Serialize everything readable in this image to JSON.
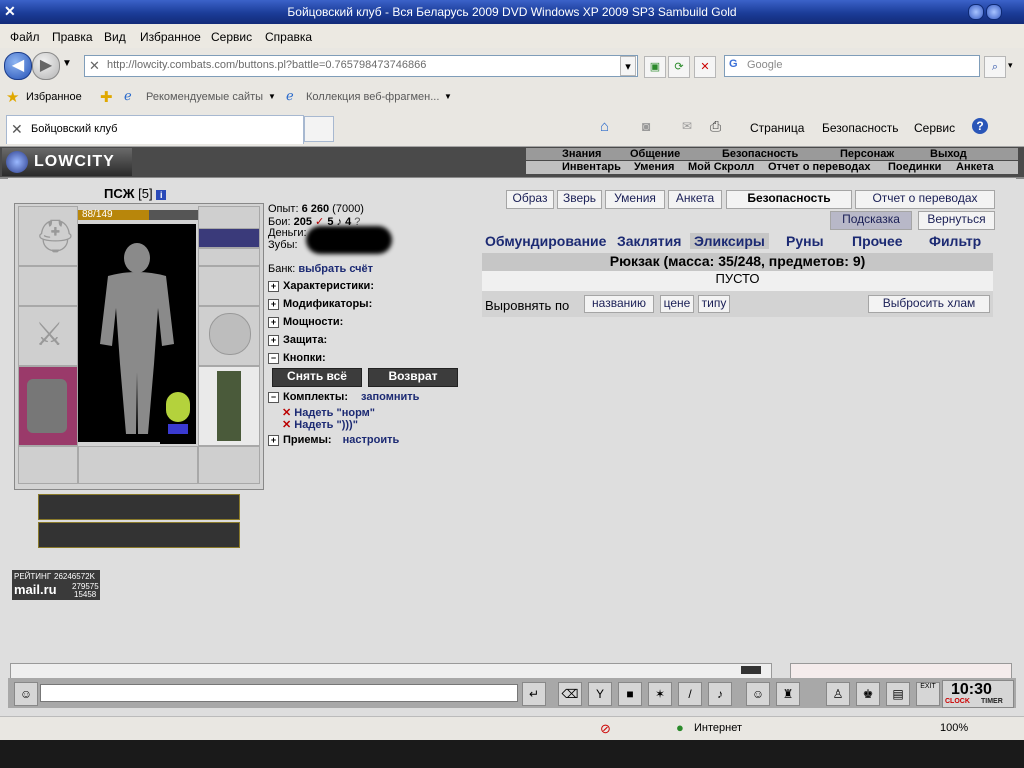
{
  "window": {
    "title": "Бойцовский клуб - Вся Беларусь 2009 DVD Windows XP 2009 SP3 Sambuild Gold"
  },
  "menu": [
    "Файл",
    "Правка",
    "Вид",
    "Избранное",
    "Сервис",
    "Справка"
  ],
  "address": {
    "url": "http://lowcity.combats.com/buttons.pl?battle=0.765798473746866"
  },
  "search": {
    "placeholder": "Google"
  },
  "favbar": {
    "favorites": "Избранное",
    "recommended": "Рекомендуемые сайты",
    "collection": "Коллекция веб-фрагмен..."
  },
  "tab": {
    "label": "Бойцовский клуб"
  },
  "commandbar": {
    "page": "Страница",
    "security": "Безопасность",
    "service": "Сервис"
  },
  "game": {
    "logo": "LOWCITY",
    "nav_top": [
      "Знания",
      "Общение",
      "Безопасность",
      "Персонаж",
      "Выход"
    ],
    "nav_bottom": [
      "Инвентарь",
      "Умения",
      "Мой Скролл",
      "Отчет о переводах",
      "Поединки",
      "Анкета"
    ],
    "character": {
      "name": "ПСЖ",
      "level": "[5]",
      "hp": "88/149",
      "hp_fraction": 0.59
    },
    "stats": {
      "exp_label": "Опыт:",
      "exp_value": "6 260",
      "exp_next": "(7000)",
      "fights_label": "Бои:",
      "fights_value": "205",
      "wins": "5",
      "losses": "4",
      "money_label": "Деньги:",
      "teeth_label": "Зубы:",
      "bank_label": "Банк:",
      "bank_link": "выбрать счёт"
    },
    "sections": [
      "Характеристики:",
      "Модификаторы:",
      "Мощности:",
      "Защита:",
      "Кнопки:"
    ],
    "buttons": {
      "remove_all": "Снять всё",
      "return": "Возврат"
    },
    "sets": {
      "label": "Комплекты:",
      "link": "запомнить",
      "items": [
        "Надеть \"норм\"",
        "Надеть \")))\""
      ]
    },
    "moves": {
      "label": "Приемы:",
      "link": "настроить"
    },
    "top_buttons": [
      "Образ",
      "Зверь",
      "Умения",
      "Анкета",
      "Безопасность",
      "Отчет о переводах"
    ],
    "hint": "Подсказка",
    "back": "Вернуться",
    "inv_tabs": [
      "Обмундирование",
      "Заклятия",
      "Эликсиры",
      "Руны",
      "Прочее",
      "Фильтр"
    ],
    "bag": "Рюкзак (масса: 35/248, предметов: 9)",
    "empty": "ПУСТО",
    "sort_label": "Выровнять по",
    "sort_options": [
      "названию",
      "цене",
      "типу"
    ],
    "throw_junk": "Выбросить хлам",
    "rating": {
      "label": "РЕЙТИНГ",
      "value": "26246572K",
      "mail": "mail.ru",
      "num1": "279575",
      "num2": "15458"
    },
    "clock": "10:30",
    "clock_label": "CLOCK",
    "timer_label": "TIMER",
    "exit_label": "EXIT"
  },
  "status": {
    "zone": "Интернет",
    "zoom": "100%"
  }
}
